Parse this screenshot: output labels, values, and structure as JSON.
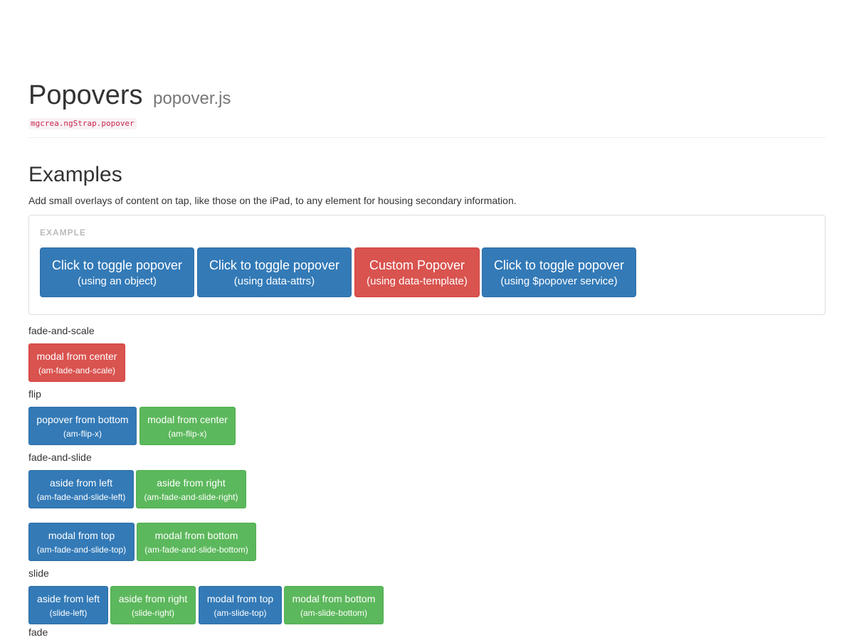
{
  "header": {
    "title": "Popovers",
    "subtitle": "popover.js",
    "module": "mgcrea.ngStrap.popover"
  },
  "examples": {
    "title": "Examples",
    "description": "Add small overlays of content on tap, like those on the iPad, to any element for housing secondary information.",
    "box_label": "EXAMPLE",
    "buttons": [
      {
        "main": "Click to toggle popover",
        "sub": "(using an object)",
        "style": "primary"
      },
      {
        "main": "Click to toggle popover",
        "sub": "(using data-attrs)",
        "style": "primary"
      },
      {
        "main": "Custom Popover",
        "sub": "(using data-template)",
        "style": "danger"
      },
      {
        "main": "Click to toggle popover",
        "sub": "(using $popover service)",
        "style": "primary"
      }
    ]
  },
  "animations": {
    "fade_and_scale": {
      "label": "fade-and-scale",
      "buttons": [
        {
          "main": "modal from center",
          "sub": "(am-fade-and-scale)"
        }
      ]
    },
    "flip": {
      "label": "flip",
      "buttons": [
        {
          "main": "popover from bottom",
          "sub": "(am-flip-x)"
        },
        {
          "main": "modal from center",
          "sub": "(am-flip-x)"
        }
      ]
    },
    "fade_and_slide": {
      "label": "fade-and-slide",
      "buttons": [
        {
          "main": "aside from left",
          "sub": "(am-fade-and-slide-left)"
        },
        {
          "main": "aside from right",
          "sub": "(am-fade-and-slide-right)"
        },
        {
          "main": "modal from top",
          "sub": "(am-fade-and-slide-top)"
        },
        {
          "main": "modal from bottom",
          "sub": "(am-fade-and-slide-bottom)"
        }
      ]
    },
    "slide": {
      "label": "slide",
      "buttons": [
        {
          "main": "aside from left",
          "sub": "(slide-left)"
        },
        {
          "main": "aside from right",
          "sub": "(slide-right)"
        },
        {
          "main": "modal from top",
          "sub": "(am-slide-top)"
        },
        {
          "main": "modal from bottom",
          "sub": "(am-slide-bottom)"
        }
      ]
    },
    "fade": {
      "label": "fade"
    }
  },
  "colors": {
    "primary": "#337ab7",
    "danger": "#d9534f",
    "success": "#5cb85c",
    "code_text": "#c7254e",
    "code_bg": "#f9f2f4"
  }
}
